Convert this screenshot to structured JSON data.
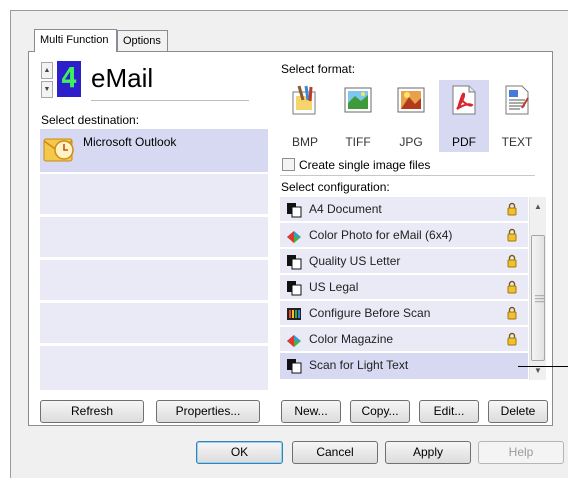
{
  "tabs": [
    {
      "label": "Multi Function",
      "active": true
    },
    {
      "label": "Options",
      "active": false
    }
  ],
  "destination": {
    "number": "4",
    "name": "eMail",
    "select_label": "Select destination:",
    "items": [
      {
        "label": "Microsoft Outlook",
        "icon": "outlook-icon",
        "selected": true
      },
      {
        "label": ""
      },
      {
        "label": ""
      },
      {
        "label": ""
      },
      {
        "label": ""
      },
      {
        "label": ""
      }
    ]
  },
  "format": {
    "select_label": "Select format:",
    "options": [
      {
        "label": "BMP",
        "icon": "bmp-paint-icon",
        "selected": false
      },
      {
        "label": "TIFF",
        "icon": "tiff-landscape-icon",
        "selected": false
      },
      {
        "label": "JPG",
        "icon": "jpg-image-icon",
        "selected": false
      },
      {
        "label": "PDF",
        "icon": "pdf-document-icon",
        "selected": true
      },
      {
        "label": "TEXT",
        "icon": "text-document-icon",
        "selected": false
      }
    ],
    "single_image_label": "Create single image files",
    "single_image_checked": false
  },
  "configuration": {
    "select_label": "Select configuration:",
    "items": [
      {
        "label": "A4 Document",
        "icon": "bw-document-icon",
        "locked": true,
        "selected": false
      },
      {
        "label": "Color Photo for eMail (6x4)",
        "icon": "color-photo-icon",
        "locked": true,
        "selected": false
      },
      {
        "label": "Quality US Letter",
        "icon": "bw-document-icon",
        "locked": true,
        "selected": false
      },
      {
        "label": "US Legal",
        "icon": "bw-document-icon",
        "locked": true,
        "selected": false
      },
      {
        "label": "Configure Before Scan",
        "icon": "configure-scan-icon",
        "locked": true,
        "selected": false
      },
      {
        "label": "Color Magazine",
        "icon": "color-photo-icon",
        "locked": true,
        "selected": false
      },
      {
        "label": "Scan for Light Text",
        "icon": "bw-document-icon",
        "locked": false,
        "selected": true
      }
    ]
  },
  "buttons": {
    "refresh": "Refresh",
    "properties": "Properties...",
    "new": "New...",
    "copy": "Copy...",
    "edit": "Edit...",
    "delete": "Delete",
    "ok": "OK",
    "cancel": "Cancel",
    "apply": "Apply",
    "help": "Help"
  },
  "colors": {
    "selection": "#d7d9f3",
    "list_row": "#e9eaf6",
    "lcd_background": "#2d1fc9",
    "lcd_digit": "#3ef060"
  }
}
